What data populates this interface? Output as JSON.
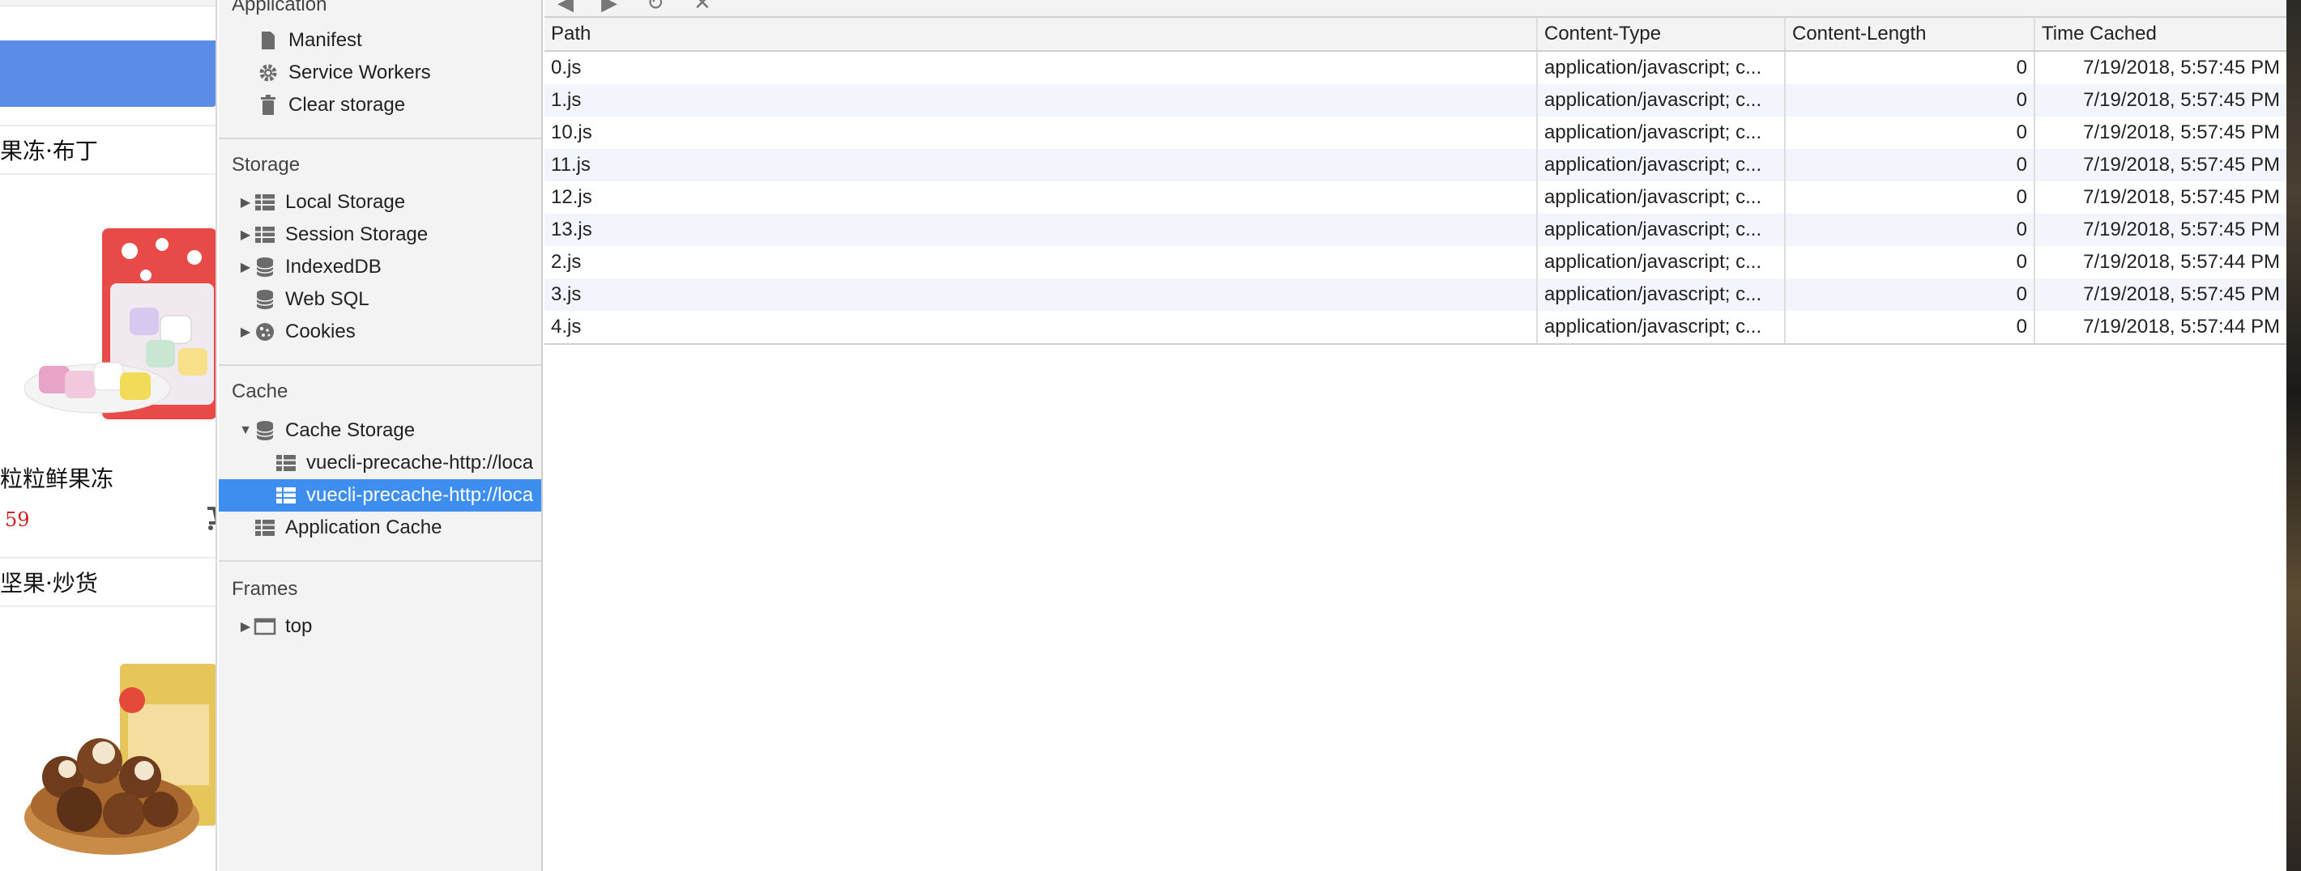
{
  "page_fragment": {
    "category_1": "果冻·布丁",
    "product_name": "粒粒鲜果冻",
    "product_price": "59",
    "category_2": "坚果·炒货"
  },
  "sidebar": {
    "app_section": "Application",
    "app_items": [
      {
        "label": "Manifest",
        "icon": "document-icon"
      },
      {
        "label": "Service Workers",
        "icon": "gear-icon"
      },
      {
        "label": "Clear storage",
        "icon": "trash-icon"
      }
    ],
    "storage_section": "Storage",
    "storage_items": [
      {
        "label": "Local Storage",
        "icon": "grid-icon"
      },
      {
        "label": "Session Storage",
        "icon": "grid-icon"
      },
      {
        "label": "IndexedDB",
        "icon": "database-icon"
      },
      {
        "label": "Web SQL",
        "icon": "database-icon"
      },
      {
        "label": "Cookies",
        "icon": "cookie-icon"
      }
    ],
    "cache_section": "Cache",
    "cache_items": [
      {
        "label": "Cache Storage",
        "icon": "database-icon"
      },
      {
        "label": "vuecli-precache-http://loca",
        "icon": "grid-icon"
      },
      {
        "label": "vuecli-precache-http://loca",
        "icon": "grid-icon",
        "selected": true
      },
      {
        "label": "Application Cache",
        "icon": "grid-icon"
      }
    ],
    "frames_section": "Frames",
    "frames_items": [
      {
        "label": "top",
        "icon": "frame-icon"
      }
    ]
  },
  "table": {
    "columns": [
      "Path",
      "Content-Type",
      "Content-Length",
      "Time Cached"
    ],
    "rows": [
      {
        "path": "0.js",
        "type": "application/javascript; c...",
        "length": "0",
        "time": "7/19/2018, 5:57:45 PM"
      },
      {
        "path": "1.js",
        "type": "application/javascript; c...",
        "length": "0",
        "time": "7/19/2018, 5:57:45 PM"
      },
      {
        "path": "10.js",
        "type": "application/javascript; c...",
        "length": "0",
        "time": "7/19/2018, 5:57:45 PM"
      },
      {
        "path": "11.js",
        "type": "application/javascript; c...",
        "length": "0",
        "time": "7/19/2018, 5:57:45 PM"
      },
      {
        "path": "12.js",
        "type": "application/javascript; c...",
        "length": "0",
        "time": "7/19/2018, 5:57:45 PM"
      },
      {
        "path": "13.js",
        "type": "application/javascript; c...",
        "length": "0",
        "time": "7/19/2018, 5:57:45 PM"
      },
      {
        "path": "2.js",
        "type": "application/javascript; c...",
        "length": "0",
        "time": "7/19/2018, 5:57:44 PM"
      },
      {
        "path": "3.js",
        "type": "application/javascript; c...",
        "length": "0",
        "time": "7/19/2018, 5:57:45 PM"
      },
      {
        "path": "4.js",
        "type": "application/javascript; c...",
        "length": "0",
        "time": "7/19/2018, 5:57:44 PM"
      }
    ]
  },
  "colors": {
    "selection": "#3e8ef0",
    "page_blue_bar": "#5b8de6",
    "price_red": "#cc2222",
    "row_alt": "#f2f6fc"
  }
}
